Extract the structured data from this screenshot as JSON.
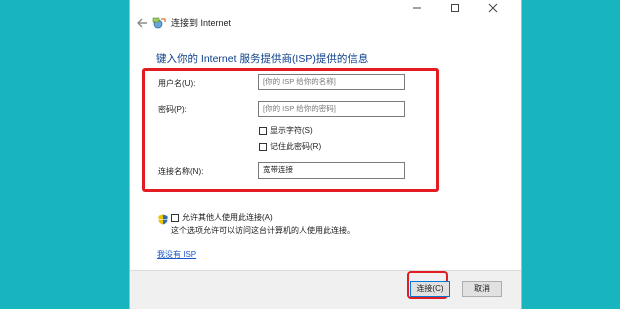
{
  "window": {
    "title": "连接到 Internet",
    "heading": "键入你的 Internet 服务提供商(ISP)提供的信息"
  },
  "form": {
    "username_label": "用户名(U):",
    "username_placeholder": "[你的 ISP 给你的名称]",
    "password_label": "密码(P):",
    "password_placeholder": "[你的 ISP 给你的密码]",
    "show_chars_label": "显示字符(S)",
    "remember_label": "记住此密码(R)",
    "connection_name_label": "连接名称(N):",
    "connection_name_value": "宽带连接"
  },
  "sharing": {
    "allow_label": "允许其他人使用此连接(A)",
    "description": "这个选项允许可以访问这台计算机的人使用此连接。"
  },
  "link": {
    "no_isp": "我没有 ISP"
  },
  "footer": {
    "connect_label": "连接(C)",
    "cancel_label": "取消"
  },
  "colors": {
    "desktop": "#19b5bf",
    "heading": "#0b3f8a",
    "link": "#1a55c8",
    "highlight": "#e31b23"
  },
  "icons": {
    "back": "back-arrow-icon",
    "network": "network-icon",
    "shield": "uac-shield-icon"
  }
}
